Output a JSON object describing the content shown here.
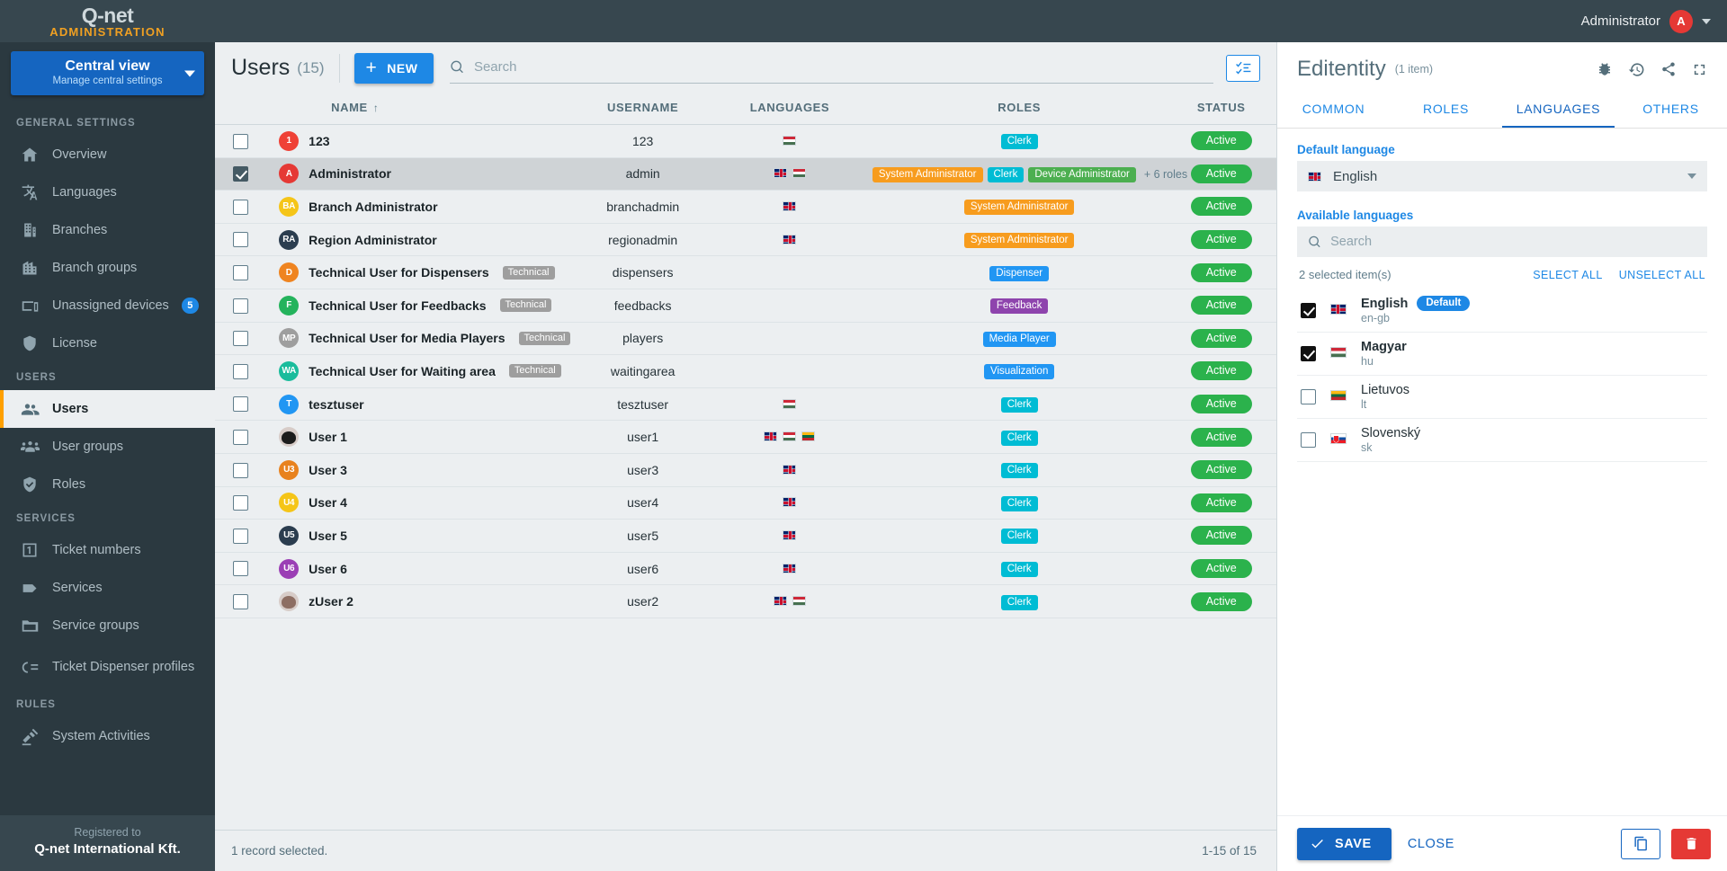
{
  "brand": {
    "logo": "Q-net",
    "sub": "ADMINISTRATION"
  },
  "view_selector": {
    "title": "Central view",
    "subtitle": "Manage central settings"
  },
  "topbar": {
    "user": "Administrator",
    "avatar_initial": "A"
  },
  "sidebar": {
    "sections": [
      {
        "label": "GENERAL SETTINGS",
        "items": [
          {
            "label": "Overview",
            "icon": "home-icon",
            "active": false
          },
          {
            "label": "Languages",
            "icon": "translate-icon",
            "active": false
          },
          {
            "label": "Branches",
            "icon": "building-icon",
            "active": false
          },
          {
            "label": "Branch groups",
            "icon": "buildings-icon",
            "active": false
          },
          {
            "label": "Unassigned devices",
            "icon": "devices-icon",
            "badge": "5",
            "active": false
          },
          {
            "label": "License",
            "icon": "shield-icon",
            "active": false
          }
        ]
      },
      {
        "label": "USERS",
        "items": [
          {
            "label": "Users",
            "icon": "users-icon",
            "active": true
          },
          {
            "label": "User groups",
            "icon": "user-group-icon",
            "active": false
          },
          {
            "label": "Roles",
            "icon": "shield-check-icon",
            "active": false
          }
        ]
      },
      {
        "label": "SERVICES",
        "items": [
          {
            "label": "Ticket numbers",
            "icon": "ticket-number-icon",
            "active": false
          },
          {
            "label": "Services",
            "icon": "tag-icon",
            "active": false
          },
          {
            "label": "Service groups",
            "icon": "folder-icon",
            "active": false
          },
          {
            "label": "Ticket Dispenser profiles",
            "icon": "dispenser-icon",
            "active": false
          }
        ]
      },
      {
        "label": "RULES",
        "items": [
          {
            "label": "System Activities",
            "icon": "gavel-icon",
            "active": false
          }
        ]
      }
    ],
    "registered": {
      "line1": "Registered to",
      "line2": "Q-net International Kft."
    }
  },
  "main": {
    "title": "Users",
    "count": "(15)",
    "new_button": "NEW",
    "search_placeholder": "Search",
    "search_value": "",
    "columns": [
      "NAME",
      "USERNAME",
      "LANGUAGES",
      "ROLES",
      "STATUS"
    ],
    "sort_indicator": "↑",
    "footer_left": "1 record selected.",
    "footer_right": "1-15 of 15",
    "rows": [
      {
        "checked": false,
        "avatar": "1",
        "avatar_color": "#ef4136",
        "name": "123",
        "tag": "",
        "username": "123",
        "languages": [
          "hu"
        ],
        "roles": [
          {
            "label": "Clerk",
            "color": "#00bcd4"
          }
        ],
        "more_roles": "",
        "status": "Active"
      },
      {
        "checked": true,
        "avatar": "A",
        "avatar_color": "#e53935",
        "name": "Administrator",
        "tag": "",
        "username": "admin",
        "languages": [
          "gb",
          "hu"
        ],
        "roles": [
          {
            "label": "System Administrator",
            "color": "#f79c1e"
          },
          {
            "label": "Clerk",
            "color": "#00bcd4"
          },
          {
            "label": "Device Administrator",
            "color": "#4caf50"
          }
        ],
        "more_roles": "+ 6 roles",
        "status": "Active"
      },
      {
        "checked": false,
        "avatar": "BA",
        "avatar_color": "#f5c518",
        "name": "Branch Administrator",
        "tag": "",
        "username": "branchadmin",
        "languages": [
          "gb"
        ],
        "roles": [
          {
            "label": "System Administrator",
            "color": "#f79c1e"
          }
        ],
        "more_roles": "",
        "status": "Active"
      },
      {
        "checked": false,
        "avatar": "RA",
        "avatar_color": "#2b3d4f",
        "name": "Region Administrator",
        "tag": "",
        "username": "regionadmin",
        "languages": [
          "gb"
        ],
        "roles": [
          {
            "label": "System Administrator",
            "color": "#f79c1e"
          }
        ],
        "more_roles": "",
        "status": "Active"
      },
      {
        "checked": false,
        "avatar": "D",
        "avatar_color": "#ef8420",
        "name": "Technical User for Dispensers",
        "tag": "Technical",
        "username": "dispensers",
        "languages": [],
        "roles": [
          {
            "label": "Dispenser",
            "color": "#2196f3"
          }
        ],
        "more_roles": "",
        "status": "Active"
      },
      {
        "checked": false,
        "avatar": "F",
        "avatar_color": "#24b35c",
        "name": "Technical User for Feedbacks",
        "tag": "Technical",
        "username": "feedbacks",
        "languages": [],
        "roles": [
          {
            "label": "Feedback",
            "color": "#8e44ad"
          }
        ],
        "more_roles": "",
        "status": "Active"
      },
      {
        "checked": false,
        "avatar": "MP",
        "avatar_color": "#9e9e9e",
        "name": "Technical User for Media Players",
        "tag": "Technical",
        "username": "players",
        "languages": [],
        "roles": [
          {
            "label": "Media Player",
            "color": "#2196f3"
          }
        ],
        "more_roles": "",
        "status": "Active"
      },
      {
        "checked": false,
        "avatar": "WA",
        "avatar_color": "#1abc9c",
        "name": "Technical User for Waiting area",
        "tag": "Technical",
        "username": "waitingarea",
        "languages": [],
        "roles": [
          {
            "label": "Visualization",
            "color": "#2196f3"
          }
        ],
        "more_roles": "",
        "status": "Active"
      },
      {
        "checked": false,
        "avatar": "T",
        "avatar_color": "#2196f3",
        "name": "tesztuser",
        "tag": "",
        "username": "tesztuser",
        "languages": [
          "hu"
        ],
        "roles": [
          {
            "label": "Clerk",
            "color": "#00bcd4"
          }
        ],
        "more_roles": "",
        "status": "Active"
      },
      {
        "checked": false,
        "avatar": "",
        "avatar_photo": true,
        "avatar_color": "#d7ccc8",
        "name": "User 1",
        "tag": "",
        "username": "user1",
        "languages": [
          "gb",
          "hu",
          "lt"
        ],
        "roles": [
          {
            "label": "Clerk",
            "color": "#00bcd4"
          }
        ],
        "more_roles": "",
        "status": "Active"
      },
      {
        "checked": false,
        "avatar": "U3",
        "avatar_color": "#e8821e",
        "name": "User 3",
        "tag": "",
        "username": "user3",
        "languages": [
          "gb"
        ],
        "roles": [
          {
            "label": "Clerk",
            "color": "#00bcd4"
          }
        ],
        "more_roles": "",
        "status": "Active"
      },
      {
        "checked": false,
        "avatar": "U4",
        "avatar_color": "#f5c518",
        "name": "User 4",
        "tag": "",
        "username": "user4",
        "languages": [
          "gb"
        ],
        "roles": [
          {
            "label": "Clerk",
            "color": "#00bcd4"
          }
        ],
        "more_roles": "",
        "status": "Active"
      },
      {
        "checked": false,
        "avatar": "U5",
        "avatar_color": "#2b3d4f",
        "name": "User 5",
        "tag": "",
        "username": "user5",
        "languages": [
          "gb"
        ],
        "roles": [
          {
            "label": "Clerk",
            "color": "#00bcd4"
          }
        ],
        "more_roles": "",
        "status": "Active"
      },
      {
        "checked": false,
        "avatar": "U6",
        "avatar_color": "#9b3fb5",
        "name": "User 6",
        "tag": "",
        "username": "user6",
        "languages": [
          "gb"
        ],
        "roles": [
          {
            "label": "Clerk",
            "color": "#00bcd4"
          }
        ],
        "more_roles": "",
        "status": "Active"
      },
      {
        "checked": false,
        "avatar": "",
        "avatar_photo2": true,
        "avatar_color": "#b08d57",
        "name": "zUser 2",
        "tag": "",
        "username": "user2",
        "languages": [
          "gb",
          "hu"
        ],
        "roles": [
          {
            "label": "Clerk",
            "color": "#00bcd4"
          }
        ],
        "more_roles": "",
        "status": "Active"
      }
    ]
  },
  "panel": {
    "title": "Editentity",
    "subtitle": "(1 item)",
    "icons": [
      "bug-icon",
      "history-icon",
      "share-icon",
      "fullscreen-icon"
    ],
    "tabs": [
      {
        "label": "COMMON",
        "active": false
      },
      {
        "label": "ROLES",
        "active": false
      },
      {
        "label": "LANGUAGES",
        "active": true
      },
      {
        "label": "OTHERS",
        "active": false
      }
    ],
    "default_language_label": "Default language",
    "default_language_value": "English",
    "default_language_flag": "gb",
    "available_languages_label": "Available languages",
    "lang_search_placeholder": "Search",
    "lang_search_value": "",
    "selected_count": "2 selected item(s)",
    "select_all": "SELECT ALL",
    "unselect_all": "UNSELECT ALL",
    "default_pill": "Default",
    "languages": [
      {
        "checked": true,
        "flag": "gb",
        "name": "English",
        "code": "en-gb",
        "default": true
      },
      {
        "checked": true,
        "flag": "hu",
        "name": "Magyar",
        "code": "hu",
        "default": false
      },
      {
        "checked": false,
        "flag": "lt",
        "name": "Lietuvos",
        "code": "lt",
        "default": false
      },
      {
        "checked": false,
        "flag": "sk",
        "name": "Slovenský",
        "code": "sk",
        "default": false
      }
    ],
    "save_label": "SAVE",
    "close_label": "CLOSE"
  }
}
